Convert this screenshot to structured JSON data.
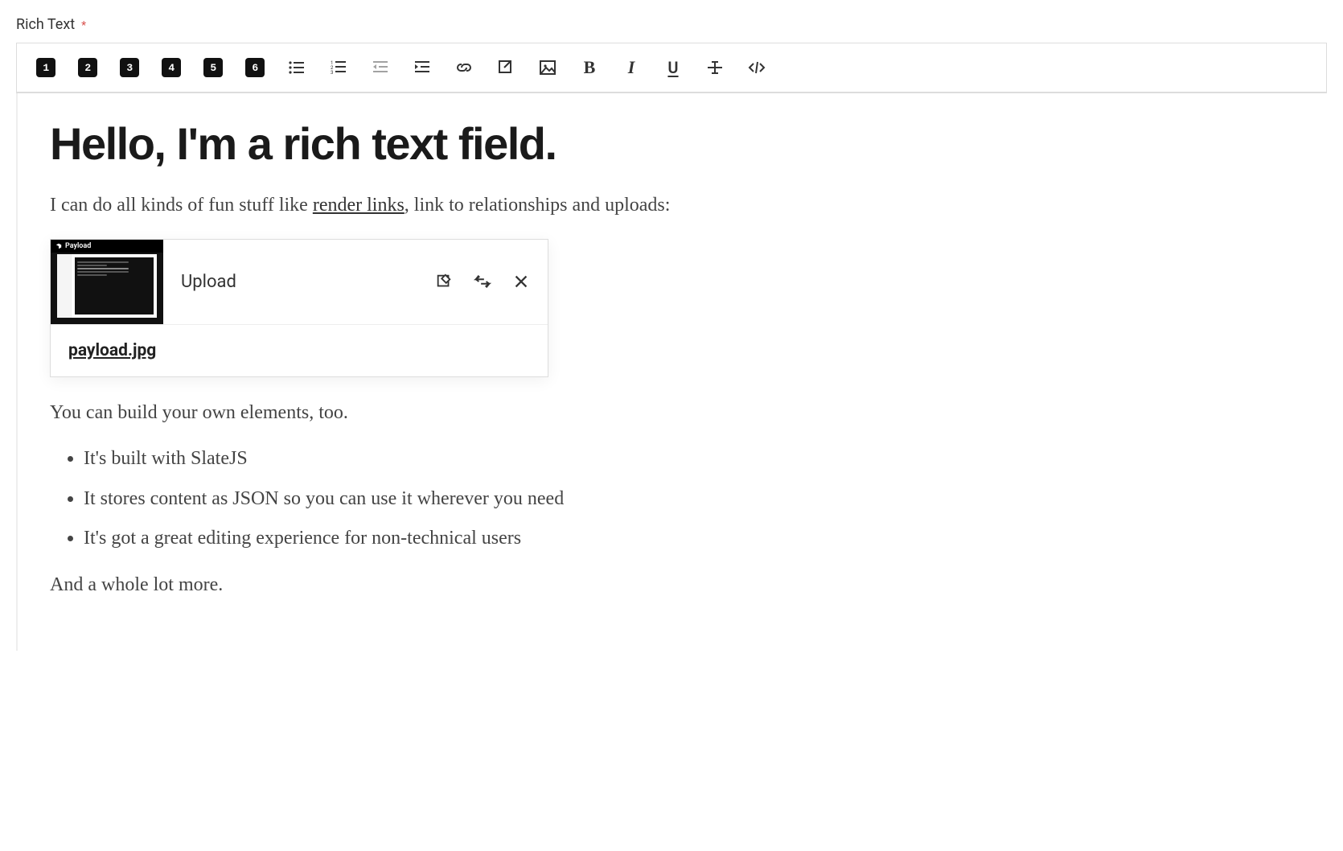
{
  "field": {
    "label": "Rich Text",
    "required_mark": "*"
  },
  "toolbar": {
    "h1": "1",
    "h2": "2",
    "h3": "3",
    "h4": "4",
    "h5": "5",
    "h6": "6",
    "bold": "B",
    "italic": "I",
    "underline": "U"
  },
  "content": {
    "heading": "Hello, I'm a rich text field.",
    "para1_pre": "I can do all kinds of fun stuff like ",
    "para1_link": "render links",
    "para1_post": ", link to relationships and uploads:",
    "upload": {
      "label": "Upload",
      "filename": "payload.jpg",
      "thumb_brand": "Payload"
    },
    "para2": "You can build your own elements, too.",
    "bullets": [
      "It's built with SlateJS",
      "It stores content as JSON so you can use it wherever you need",
      "It's got a great editing experience for non-technical users"
    ],
    "para3": "And a whole lot more."
  }
}
